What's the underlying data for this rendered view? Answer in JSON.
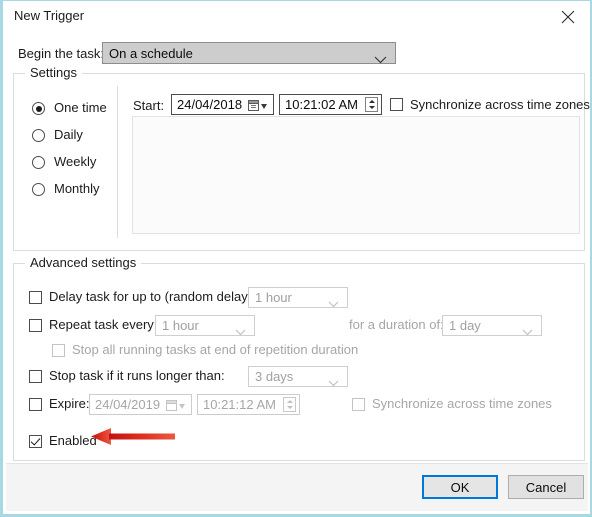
{
  "window": {
    "title": "New Trigger",
    "close_icon": "close-icon"
  },
  "begin": {
    "label": "Begin the task:",
    "value": "On a schedule",
    "chevron_icon": "chevron-down-icon"
  },
  "settings": {
    "legend": "Settings",
    "schedule_options": [
      {
        "label": "One time",
        "selected": true
      },
      {
        "label": "Daily",
        "selected": false
      },
      {
        "label": "Weekly",
        "selected": false
      },
      {
        "label": "Monthly",
        "selected": false
      }
    ],
    "start_label": "Start:",
    "start_date": "24/04/2018",
    "start_time": "10:21:02 AM",
    "calendar_icon": "calendar-icon",
    "spinner_icon": "spinner-updown-icon",
    "sync_timezones_label": "Synchronize across time zones",
    "sync_timezones_checked": false
  },
  "advanced": {
    "legend": "Advanced settings",
    "delay_task": {
      "label": "Delay task for up to (random delay):",
      "checked": false,
      "value": "1 hour"
    },
    "repeat_task": {
      "label": "Repeat task every:",
      "checked": false,
      "value": "1 hour",
      "duration_label": "for a duration of:",
      "duration_value": "1 day"
    },
    "stop_all_running": {
      "label": "Stop all running tasks at end of repetition duration",
      "checked": false
    },
    "stop_task": {
      "label": "Stop task if it runs longer than:",
      "checked": false,
      "value": "3 days"
    },
    "expire": {
      "label": "Expire:",
      "checked": false,
      "date": "24/04/2019",
      "time": "10:21:12 AM",
      "sync_label": "Synchronize across time zones",
      "sync_checked": false
    },
    "enabled": {
      "label": "Enabled",
      "checked": true
    }
  },
  "annotation": {
    "arrow_icon": "red-arrow-left-icon",
    "arrow_color": "#d42020"
  },
  "footer": {
    "ok_label": "OK",
    "cancel_label": "Cancel"
  }
}
